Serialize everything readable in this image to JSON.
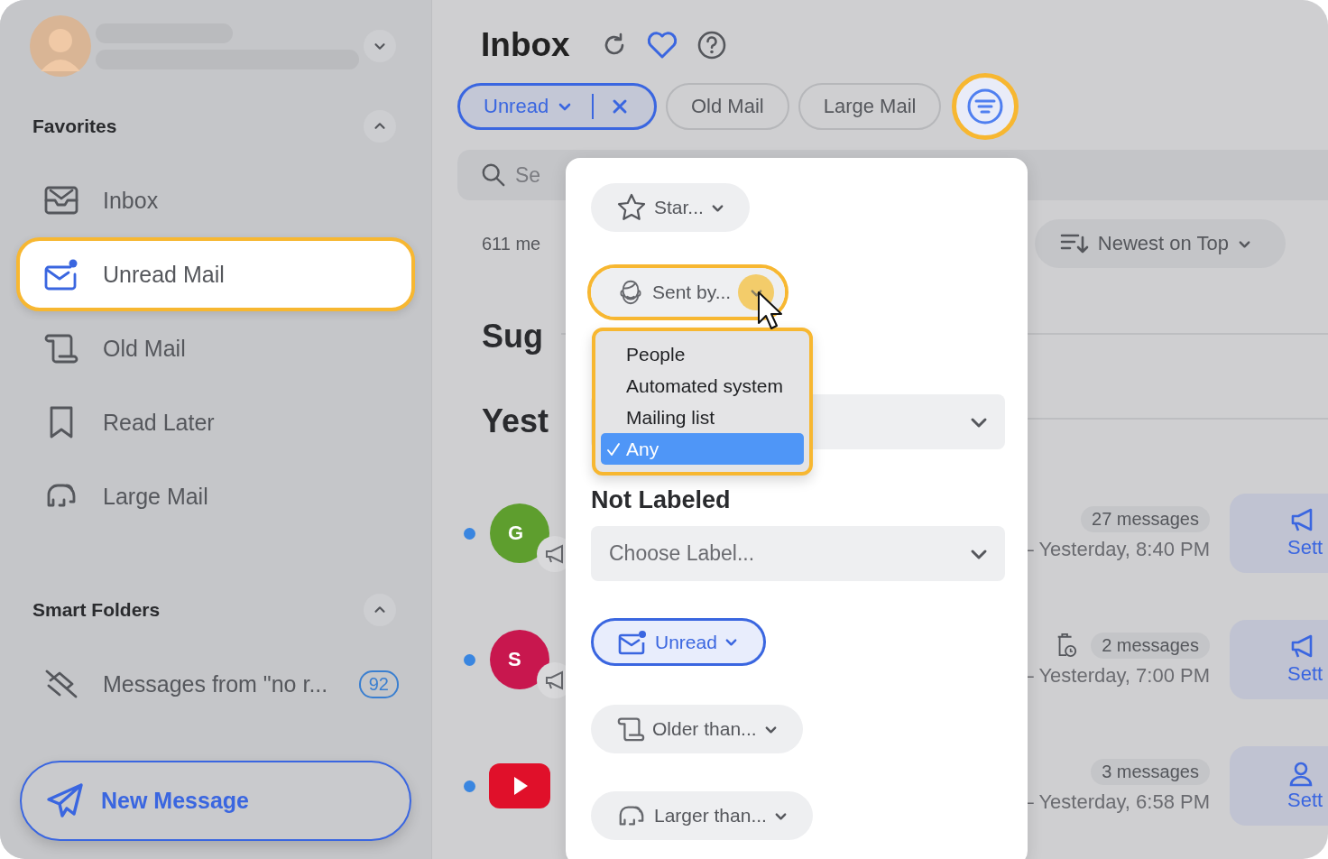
{
  "sidebar": {
    "sections": [
      {
        "title": "Favorites",
        "expanded": true,
        "items": [
          {
            "kind": "inbox",
            "label": "Inbox",
            "selected": false
          },
          {
            "kind": "unread",
            "label": "Unread Mail",
            "selected": true
          },
          {
            "kind": "old",
            "label": "Old Mail",
            "selected": false
          },
          {
            "kind": "later",
            "label": "Read Later",
            "selected": false
          },
          {
            "kind": "large",
            "label": "Large Mail",
            "selected": false
          }
        ]
      },
      {
        "title": "Smart Folders",
        "expanded": true,
        "items": [
          {
            "kind": "no-reply",
            "label": "Messages from \"no r...",
            "count": "92",
            "selected": false
          }
        ]
      }
    ],
    "new_message_button": "New Message"
  },
  "header": {
    "title": "Inbox"
  },
  "filter_chips": [
    {
      "label": "Unread",
      "selected": true
    },
    {
      "label": "Old Mail",
      "selected": false
    },
    {
      "label": "Large Mail",
      "selected": false
    }
  ],
  "filter_button": {
    "highlighted": true
  },
  "search": {
    "placeholder": "Se"
  },
  "message_count": "611 me",
  "sort_button": "Newest on Top",
  "section_headings": [
    "Sug",
    "Yest"
  ],
  "threads": [
    {
      "unread": true,
      "kind": "initials",
      "initials": "G",
      "color": "#5e9e2e",
      "badge": true,
      "auto_delete": false,
      "count": "27 messages",
      "date": "– Yesterday, 8:40 PM",
      "action": {
        "kind": "megaphone",
        "label": "Sett"
      }
    },
    {
      "unread": true,
      "kind": "initials",
      "initials": "S",
      "color": "#c8174e",
      "badge": true,
      "auto_delete": true,
      "count": "2 messages",
      "date": "– Yesterday, 7:00 PM",
      "action": {
        "kind": "megaphone",
        "label": "Sett"
      }
    },
    {
      "unread": true,
      "kind": "video",
      "color": "#e0102a",
      "badge": false,
      "auto_delete": false,
      "count": "3 messages",
      "date": "– Yesterday, 6:58 PM",
      "action": {
        "kind": "person",
        "label": "Sett"
      }
    }
  ],
  "filter_panel": {
    "star_filter": "Star...",
    "sent_by": {
      "label": "Sent by...",
      "highlighted": true,
      "options": [
        {
          "label": "People",
          "selected": false
        },
        {
          "label": "Automated system",
          "selected": false
        },
        {
          "label": "Mailing list",
          "selected": false
        },
        {
          "label": "Any",
          "selected": true
        }
      ]
    },
    "label_heading": "Not Labeled",
    "label_select": {
      "placeholder": "Choose Label..."
    },
    "unread_filter": {
      "label": "Unread",
      "active": true
    },
    "older_filter": "Older than...",
    "larger_filter": "Larger than..."
  }
}
